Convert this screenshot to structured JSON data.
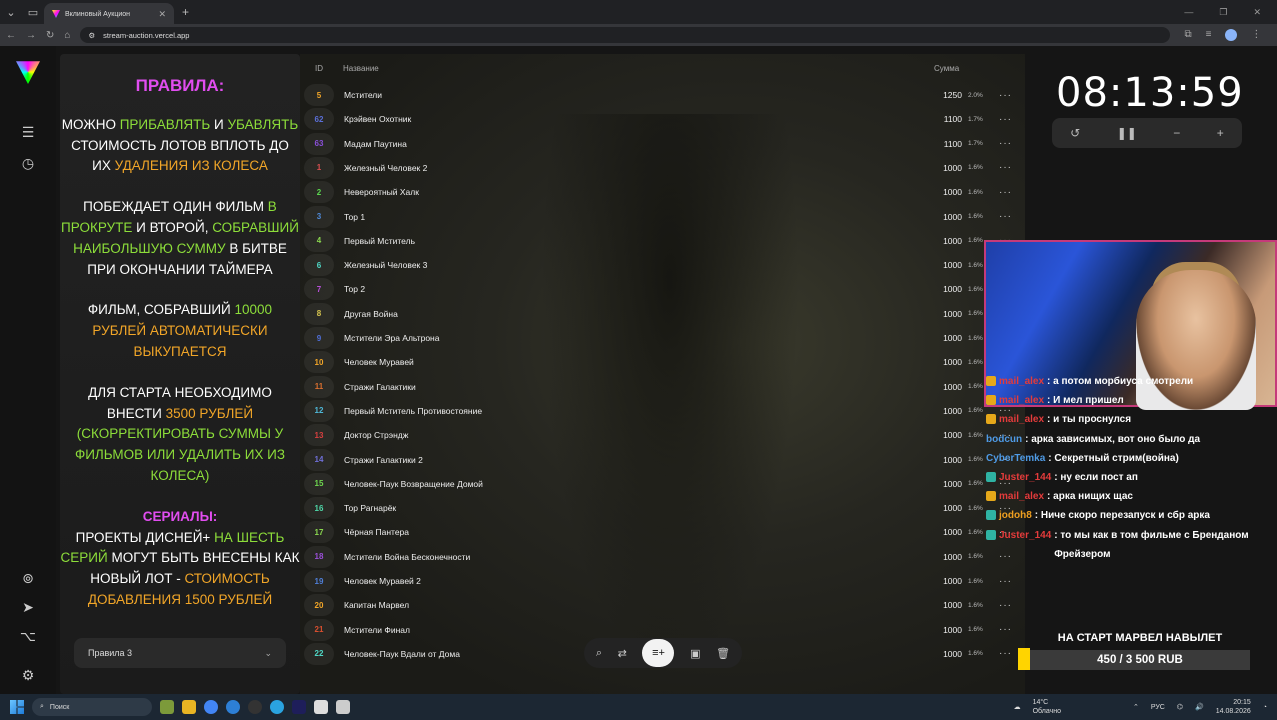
{
  "browser": {
    "tab_title": "Вклиновый Аукцион",
    "url": "stream-auction.vercel.app"
  },
  "rules": {
    "title": "ПРАВИЛА:",
    "p1": [
      "МОЖНО ",
      "ПРИБАВЛЯТЬ",
      " И ",
      "УБАВЛЯТЬ",
      " СТОИМОСТЬ ЛОТОВ ВПЛОТЬ ДО ИХ ",
      "УДАЛЕНИЯ ИЗ КОЛЕСА"
    ],
    "p2": [
      "ПОБЕЖДАЕТ ОДИН ФИЛЬМ ",
      "В ПРОКРУТЕ",
      " И ВТОРОЙ, ",
      "СОБРАВШИЙ НАИБОЛЬШУЮ СУММУ",
      " В БИТВЕ ПРИ ОКОНЧАНИИ ТАЙМЕРА"
    ],
    "p3": [
      "ФИЛЬМ, СОБРАВШИЙ ",
      "10000",
      " ",
      "РУБЛЕЙ АВТОМАТИЧЕСКИ ВЫКУПАЕТСЯ"
    ],
    "p4": [
      "ДЛЯ СТАРТА НЕОБХОДИМО ВНЕСТИ ",
      "3500 РУБЛЕЙ",
      " ",
      "(СКОРРЕКТИРОВАТЬ СУММЫ У ФИЛЬМОВ ИЛИ УДАЛИТЬ ИХ ИЗ КОЛЕСА)"
    ],
    "p5": [
      "СЕРИАЛЫ:",
      " ПРОЕКТЫ ДИСНЕЙ+ ",
      "НА ШЕСТЬ СЕРИЙ",
      " МОГУТ БЫТЬ ВНЕСЕНЫ КАК НОВЫЙ ЛОТ - ",
      "СТОИМОСТЬ ДОБАВЛЕНИЯ 1500 РУБЛЕЙ"
    ],
    "select": "Правила 3"
  },
  "table": {
    "headers": {
      "id": "ID",
      "name": "Название",
      "sum": "Сумма"
    },
    "rows": [
      {
        "id": "5",
        "name": "Мстители",
        "amount": "1250",
        "pct": "2.0%",
        "color": "#f2a628"
      },
      {
        "id": "62",
        "name": "Крэйвен Охотник",
        "amount": "1100",
        "pct": "1.7%",
        "color": "#5b6fd8"
      },
      {
        "id": "63",
        "name": "Мадам Паутина",
        "amount": "1100",
        "pct": "1.7%",
        "color": "#8a4fd8"
      },
      {
        "id": "1",
        "name": "Железный Человек 2",
        "amount": "1000",
        "pct": "1.6%",
        "color": "#d84f4f"
      },
      {
        "id": "2",
        "name": "Невероятный Халк",
        "amount": "1000",
        "pct": "1.6%",
        "color": "#5bd84f"
      },
      {
        "id": "3",
        "name": "Тор 1",
        "amount": "1000",
        "pct": "1.6%",
        "color": "#4f8ad8"
      },
      {
        "id": "4",
        "name": "Первый Мститель",
        "amount": "1000",
        "pct": "1.6%",
        "color": "#8ad84f"
      },
      {
        "id": "6",
        "name": "Железный Человек 3",
        "amount": "1000",
        "pct": "1.6%",
        "color": "#4fd8c6"
      },
      {
        "id": "7",
        "name": "Тор 2",
        "amount": "1000",
        "pct": "1.6%",
        "color": "#b84fd8"
      },
      {
        "id": "8",
        "name": "Другая Война",
        "amount": "1000",
        "pct": "1.6%",
        "color": "#d8c64f"
      },
      {
        "id": "9",
        "name": "Мстители Эра Альтрона",
        "amount": "1000",
        "pct": "1.6%",
        "color": "#4f6fd8"
      },
      {
        "id": "10",
        "name": "Человек Муравей",
        "amount": "1000",
        "pct": "1.6%",
        "color": "#f2a628"
      },
      {
        "id": "11",
        "name": "Стражи Галактики",
        "amount": "1000",
        "pct": "1.6%",
        "color": "#d86f2f"
      },
      {
        "id": "12",
        "name": "Первый Мститель Противостояние",
        "amount": "1000",
        "pct": "1.6%",
        "color": "#4fb8d8"
      },
      {
        "id": "13",
        "name": "Доктор Стрэндж",
        "amount": "1000",
        "pct": "1.6%",
        "color": "#d83f3f"
      },
      {
        "id": "14",
        "name": "Стражи Галактики 2",
        "amount": "1000",
        "pct": "1.6%",
        "color": "#6f6fd8"
      },
      {
        "id": "15",
        "name": "Человек-Паук Возвращение Домой",
        "amount": "1000",
        "pct": "1.6%",
        "color": "#6fd84f"
      },
      {
        "id": "16",
        "name": "Тор Рагнарёк",
        "amount": "1000",
        "pct": "1.6%",
        "color": "#4fd8a8"
      },
      {
        "id": "17",
        "name": "Чёрная Пантера",
        "amount": "1000",
        "pct": "1.6%",
        "color": "#8ad84f"
      },
      {
        "id": "18",
        "name": "Мстители Война Бесконечности",
        "amount": "1000",
        "pct": "1.6%",
        "color": "#9a4fd8"
      },
      {
        "id": "19",
        "name": "Человек Муравей 2",
        "amount": "1000",
        "pct": "1.6%",
        "color": "#4f7fd8"
      },
      {
        "id": "20",
        "name": "Капитан Марвел",
        "amount": "1000",
        "pct": "1.6%",
        "color": "#f2a628"
      },
      {
        "id": "21",
        "name": "Мстители Финал",
        "amount": "1000",
        "pct": "1.6%",
        "color": "#d84f2f"
      },
      {
        "id": "22",
        "name": "Человек-Паук Вдали от Дома",
        "amount": "1000",
        "pct": "1.6%",
        "color": "#4fd8c6"
      }
    ]
  },
  "timer": {
    "value": "08:13:59"
  },
  "chat": [
    {
      "user": "mail_alex",
      "msg": ": а потом морбиуса смотрели",
      "badge": "mod",
      "color": "red"
    },
    {
      "user": "mail_alex",
      "msg": ": И мел пришел",
      "badge": "mod",
      "color": "red"
    },
    {
      "user": "mail_alex",
      "msg": ": и ты проснулся",
      "badge": "mod",
      "color": "red"
    },
    {
      "user": "bodcun",
      "msg": ": арка зависимых, вот оно было да",
      "badge": "",
      "color": "blue"
    },
    {
      "user": "CyberTemka",
      "msg": ": Секретный стрим(война)",
      "badge": "",
      "color": "blue"
    },
    {
      "user": "Juster_144",
      "msg": ": ну если пост ап",
      "badge": "sub",
      "color": "red"
    },
    {
      "user": "mail_alex",
      "msg": ": арка нищих щас",
      "badge": "mod",
      "color": "red"
    },
    {
      "user": "jodoh8",
      "msg": ": Ниче скоро перезапуск и сбр арка",
      "badge": "sub",
      "color": "orange"
    },
    {
      "user": "Juster_144",
      "msg": ": то мы как в том фильме с Бренданом Фрейзером",
      "badge": "sub",
      "color": "red"
    }
  ],
  "goal": {
    "title": "НА СТАРТ МАРВЕЛ НАВЫЛЕТ",
    "progress": "450 / 3 500 RUB",
    "fraction": 0.129
  },
  "taskbar": {
    "search": "Поиск",
    "weather_temp": "14°C",
    "weather_desc": "Облачно",
    "lang": "РУС",
    "time": "20:15",
    "date": "14.08.2026"
  }
}
